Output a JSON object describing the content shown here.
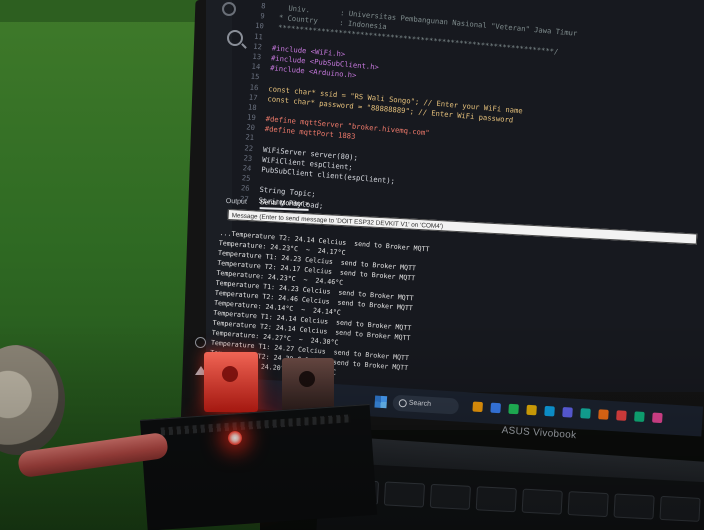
{
  "code": {
    "lines": [
      {
        "n": "8",
        "t": "   Univ.       : Universitas Pembangunan Nasional \"Veteran\" Jawa Timur",
        "cls": "c-com"
      },
      {
        "n": "9",
        "t": " * Country     : Indonesia",
        "cls": "c-com"
      },
      {
        "n": "10",
        "t": " ****************************************************************/",
        "cls": "c-com"
      },
      {
        "n": "11",
        "t": "",
        "cls": "c-txt"
      },
      {
        "n": "12",
        "t": "#include <WiFi.h>",
        "cls": "c-pre"
      },
      {
        "n": "13",
        "t": "#include <PubSubClient.h>",
        "cls": "c-pre"
      },
      {
        "n": "14",
        "t": "#include <Arduino.h>",
        "cls": "c-pre"
      },
      {
        "n": "15",
        "t": "",
        "cls": "c-txt"
      },
      {
        "n": "16",
        "t": "const char* ssid = \"RS Wali Songo\"; // Enter your WiFi name",
        "cls": "c-str"
      },
      {
        "n": "17",
        "t": "const char* password = \"88888889\"; // Enter WiFi password",
        "cls": "c-str"
      },
      {
        "n": "18",
        "t": "",
        "cls": "c-txt"
      },
      {
        "n": "19",
        "t": "#define mqttServer \"broker.hivemq.com\"",
        "cls": "c-fn"
      },
      {
        "n": "20",
        "t": "#define mqttPort 1883",
        "cls": "c-fn"
      },
      {
        "n": "21",
        "t": "",
        "cls": "c-txt"
      },
      {
        "n": "22",
        "t": "WiFiServer server(80);",
        "cls": "c-txt"
      },
      {
        "n": "23",
        "t": "WiFiClient espClient;",
        "cls": "c-txt"
      },
      {
        "n": "24",
        "t": "PubSubClient client(espClient);",
        "cls": "c-txt"
      },
      {
        "n": "25",
        "t": "",
        "cls": "c-txt"
      },
      {
        "n": "26",
        "t": "String Topic;",
        "cls": "c-txt"
      },
      {
        "n": "27",
        "t": "String Payload;",
        "cls": "c-txt"
      }
    ]
  },
  "panel": {
    "tab_output": "Output",
    "tab_serial": "Serial Monitor",
    "close_glyph": "×",
    "input_placeholder": "Message (Enter to send message to 'DOIT ESP32 DEVKIT V1' on 'COM4')"
  },
  "serial": {
    "lines": [
      "...Temperature T2: 24.14 Celcius  send to Broker MQTT",
      "Temperature: 24.23°C  ~  24.17°C",
      "Temperature T1: 24.23 Celcius  send to Broker MQTT",
      "Temperature T2: 24.17 Celcius  send to Broker MQTT",
      "Temperature: 24.23°C  ~  24.46°C",
      "Temperature T1: 24.23 Celcius  send to Broker MQTT",
      "Temperature T2: 24.46 Celcius  send to Broker MQTT",
      "Temperature: 24.14°C  ~  24.14°C",
      "Temperature T1: 24.14 Celcius  send to Broker MQTT",
      "Temperature T2: 24.14 Celcius  send to Broker MQTT",
      "Temperature: 24.27°C  ~  24.30°C",
      "Temperature T1: 24.27 Celcius  send to Broker MQTT",
      "Temperature T2: 24.30 Celcius  send to Broker MQTT",
      "Temperature: 24.20°C  ~  24.33°C"
    ]
  },
  "taskbar": {
    "search_label": "Search"
  },
  "laptop": {
    "brand": "ASUS Vivobook"
  },
  "colors": {
    "led": "#ff3a2a",
    "cable": "#c4534d",
    "wall": "#3f7a2a"
  }
}
